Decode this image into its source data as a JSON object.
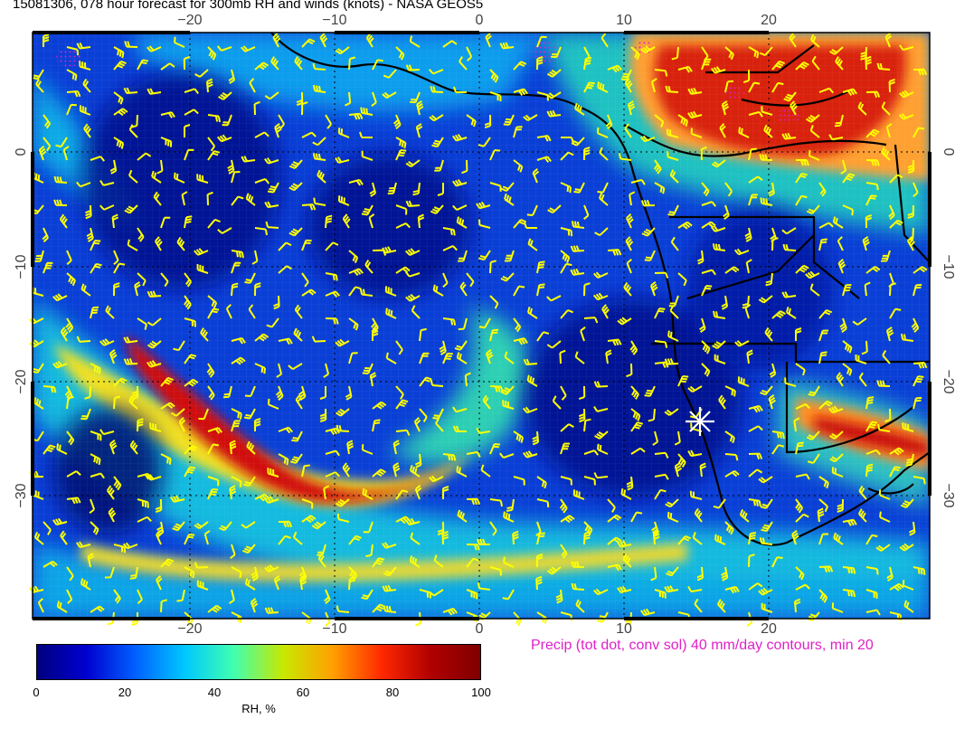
{
  "title": "15081306, 078 hour forecast for 300mb RH and winds (knots) - NASA GEOS5",
  "map": {
    "lon_ticks": [
      "−20",
      "−10",
      "0",
      "10",
      "20"
    ],
    "lat_ticks": [
      "0",
      "−10",
      "−20",
      "−30"
    ],
    "marker": "station-star"
  },
  "precip_note": "Precip (tot dot, conv sol) 40 mm/day contours, min 20",
  "colorbar": {
    "ticks": [
      "0",
      "20",
      "40",
      "60",
      "80",
      "100"
    ],
    "label": "RH, %",
    "colors": [
      "#00007f",
      "#0000d0",
      "#0060ff",
      "#00c8ff",
      "#40ffb0",
      "#c8e800",
      "#ffa000",
      "#ff2800",
      "#b00000",
      "#7f0000"
    ]
  },
  "colors": {
    "precip": "#e020c8",
    "barbs": "#ffff00",
    "coast": "#000000"
  }
}
